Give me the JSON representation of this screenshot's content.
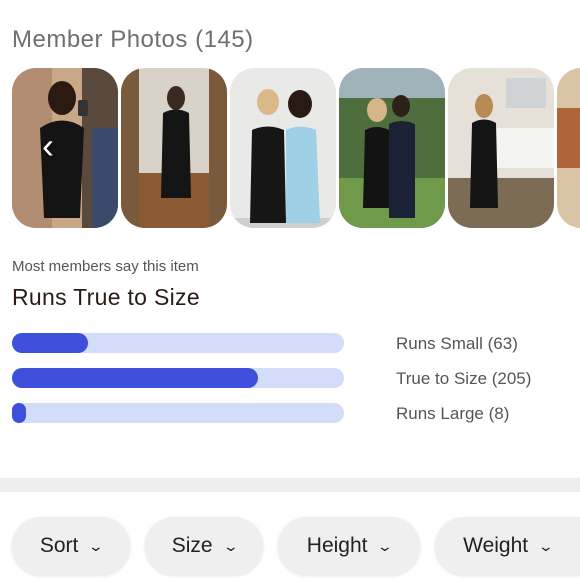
{
  "photos": {
    "title": "Member Photos (145)",
    "items": [
      {
        "name": "member-photo-1"
      },
      {
        "name": "member-photo-2"
      },
      {
        "name": "member-photo-3"
      },
      {
        "name": "member-photo-4"
      },
      {
        "name": "member-photo-5"
      },
      {
        "name": "member-photo-6"
      }
    ]
  },
  "fit": {
    "subtitle": "Most members say this item",
    "title": "Runs True to Size",
    "accent_color": "#3d4fdb",
    "track_color": "#d3dcf8",
    "rows": [
      {
        "label": "Runs Small (63)",
        "count": 63,
        "fill_fraction": 0.23
      },
      {
        "label": "True to Size (205)",
        "count": 205,
        "fill_fraction": 0.74
      },
      {
        "label": "Runs Large (8)",
        "count": 8,
        "fill_fraction": 0.04
      }
    ]
  },
  "filters": {
    "chips": [
      {
        "label": "Sort",
        "icon": "chevron-down-icon"
      },
      {
        "label": "Size",
        "icon": "chevron-down-icon"
      },
      {
        "label": "Height",
        "icon": "chevron-down-icon"
      },
      {
        "label": "Weight",
        "icon": "chevron-down-icon"
      }
    ]
  }
}
